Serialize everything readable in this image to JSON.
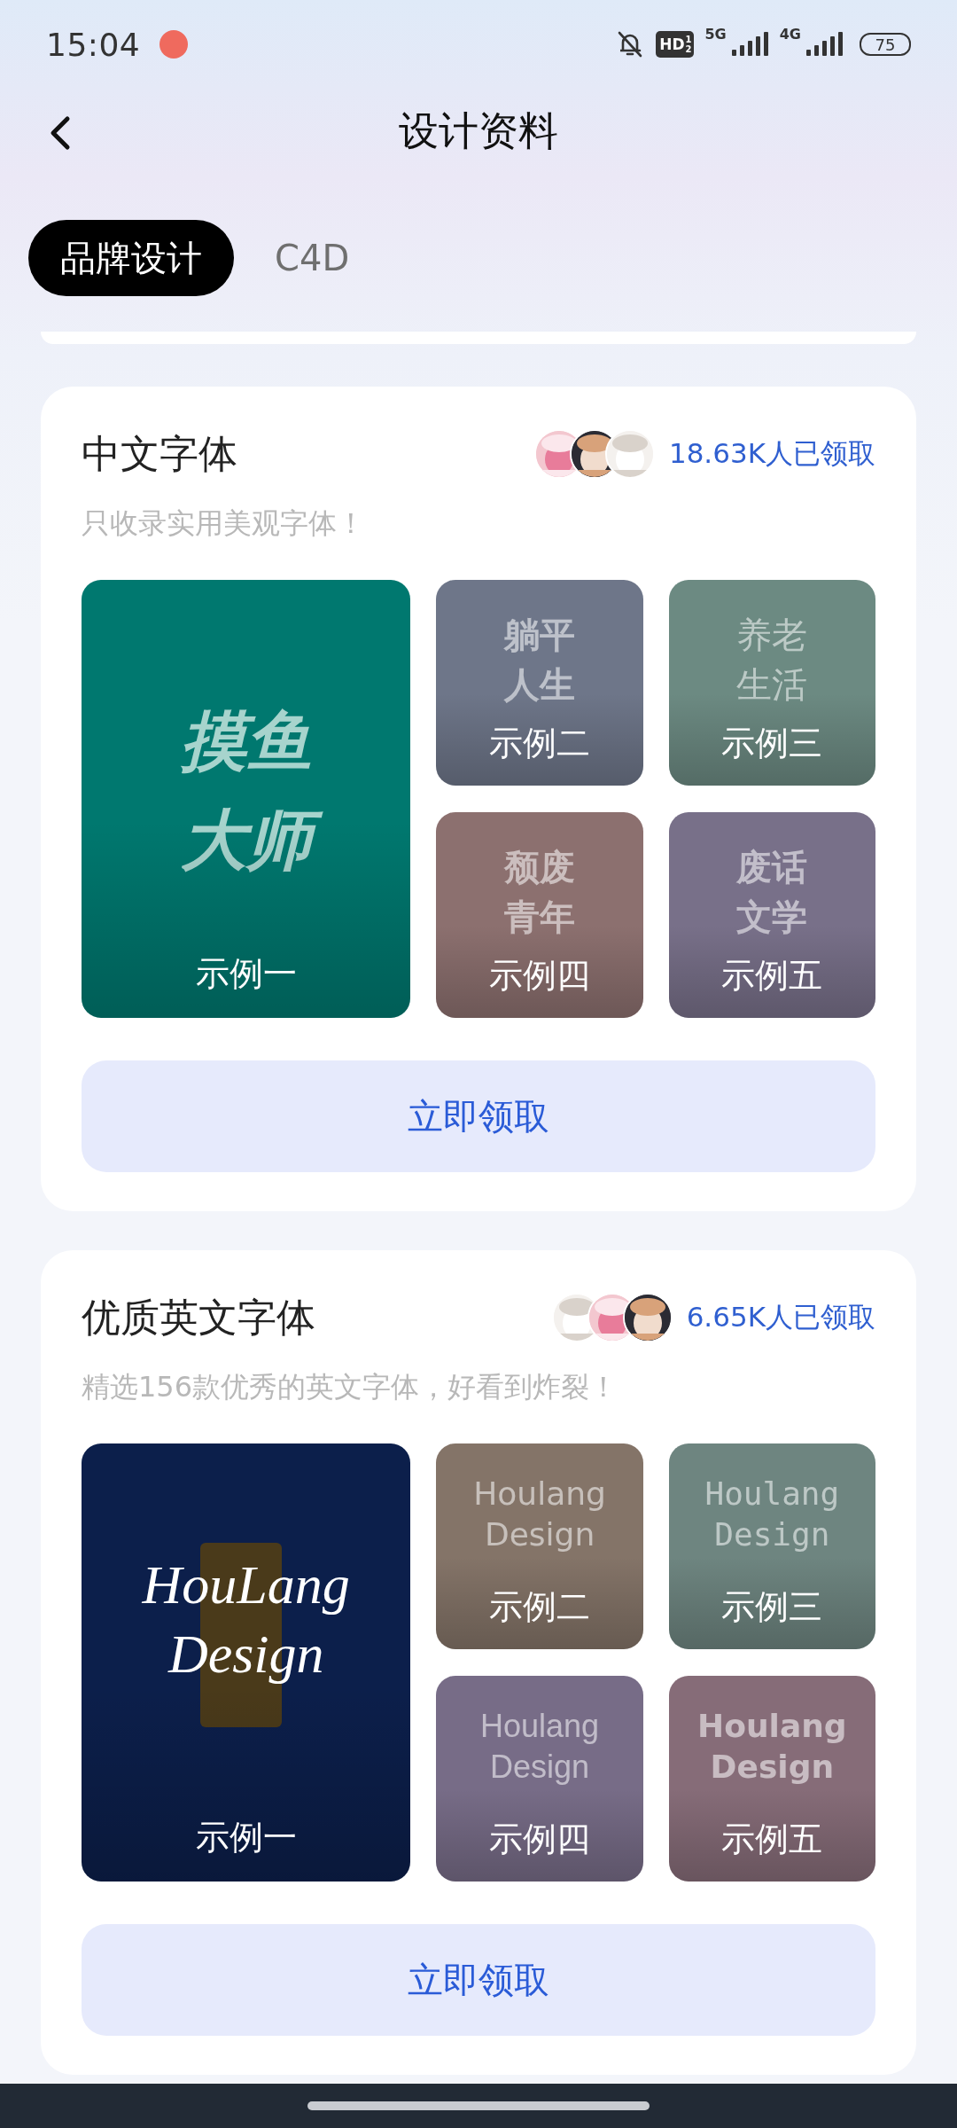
{
  "status_bar": {
    "time": "15:04",
    "hd": "HD",
    "hd_slots": [
      "1",
      "2"
    ],
    "network_1": "5G",
    "network_2": "4G",
    "battery": "75"
  },
  "header": {
    "title": "设计资料"
  },
  "tabs": [
    {
      "label": "品牌设计",
      "selected": true
    },
    {
      "label": "C4D",
      "selected": false
    }
  ],
  "sections": [
    {
      "title": "中文字体",
      "claimed": "18.63K人已领取",
      "description": "只收录实用美观字体！",
      "tiles": [
        {
          "sample": [
            "摸鱼",
            "大师"
          ],
          "color": "#00786f",
          "label": "示例一"
        },
        {
          "sample": [
            "躺平",
            "人生"
          ],
          "color": "#6e7689",
          "label": "示例二"
        },
        {
          "sample": [
            "养老",
            "生活"
          ],
          "color": "#6c8a82",
          "label": "示例三"
        },
        {
          "sample": [
            "颓废",
            "青年"
          ],
          "color": "#8c706f",
          "label": "示例四"
        },
        {
          "sample": [
            "废话",
            "文学"
          ],
          "color": "#787089",
          "label": "示例五"
        }
      ],
      "button": "立即领取"
    },
    {
      "title": "优质英文字体",
      "claimed": "6.65K人已领取",
      "description": "精选156款优秀的英文字体，好看到炸裂！",
      "tiles": [
        {
          "sample": [
            "HouLang",
            "Design"
          ],
          "color": "#0c1f4b",
          "label": "示例一",
          "highlight": true
        },
        {
          "sample": [
            "Houlang",
            "Design"
          ],
          "color": "#847468",
          "label": "示例二"
        },
        {
          "sample": [
            "Houlang",
            "Design"
          ],
          "color": "#6e8580",
          "label": "示例三"
        },
        {
          "sample": [
            "Houlang",
            "Design"
          ],
          "color": "#776c87",
          "label": "示例四"
        },
        {
          "sample": [
            "Houlang",
            "Design"
          ],
          "color": "#866c78",
          "label": "示例五"
        }
      ],
      "button": "立即领取"
    }
  ]
}
